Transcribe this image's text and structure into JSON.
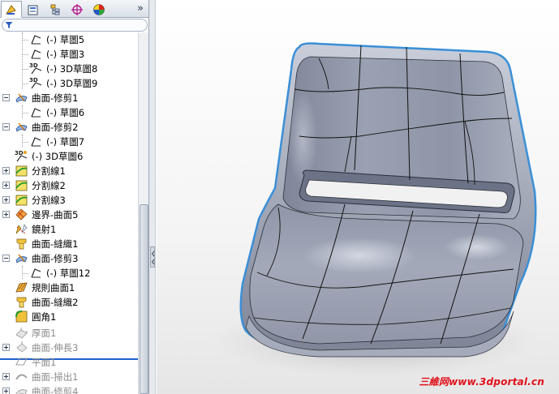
{
  "feature_tree": {
    "items": [
      {
        "label": "(-) 草圖5",
        "icon": "sketch-icon",
        "state": "active"
      },
      {
        "label": "(-) 草圖3",
        "icon": "sketch-icon",
        "state": "active"
      },
      {
        "label": "(-) 3D草圖8",
        "icon": "3d-sketch-icon",
        "state": "active"
      },
      {
        "label": "(-) 3D草圖9",
        "icon": "3d-sketch-icon",
        "state": "active"
      },
      {
        "label": "曲面-修剪1",
        "icon": "trim-surface-icon",
        "state": "active"
      },
      {
        "label": "(-) 草圖6",
        "icon": "sketch-icon",
        "state": "active"
      },
      {
        "label": "曲面-修剪2",
        "icon": "trim-surface-icon",
        "state": "active"
      },
      {
        "label": "(-) 草圖7",
        "icon": "sketch-icon",
        "state": "active"
      },
      {
        "label": "(-) 3D草圖6",
        "icon": "3d-sketch-icon",
        "state": "active"
      },
      {
        "label": "分割線1",
        "icon": "split-line-icon",
        "state": "active"
      },
      {
        "label": "分割線2",
        "icon": "split-line-icon",
        "state": "active"
      },
      {
        "label": "分割線3",
        "icon": "split-line-icon",
        "state": "active"
      },
      {
        "label": "邊界-曲面5",
        "icon": "boundary-surface-icon",
        "state": "active"
      },
      {
        "label": "鏡射1",
        "icon": "mirror-icon",
        "state": "active"
      },
      {
        "label": "曲面-縫織1",
        "icon": "knit-surface-icon",
        "state": "active"
      },
      {
        "label": "曲面-修剪3",
        "icon": "trim-surface-icon",
        "state": "active"
      },
      {
        "label": "(-) 草圖12",
        "icon": "sketch-icon",
        "state": "active"
      },
      {
        "label": "規則曲面1",
        "icon": "ruled-surface-icon",
        "state": "active"
      },
      {
        "label": "曲面-縫織2",
        "icon": "knit-surface-icon",
        "state": "active"
      },
      {
        "label": "圓角1",
        "icon": "fillet-icon",
        "state": "active"
      },
      {
        "label": "厚面1",
        "icon": "thicken-icon",
        "state": "suppressed"
      },
      {
        "label": "曲面-伸長3",
        "icon": "extrude-surface-icon",
        "state": "suppressed"
      },
      {
        "label": "平面1",
        "icon": "plane-icon",
        "state": "suppressed"
      },
      {
        "label": "曲面-掃出1",
        "icon": "sweep-surface-icon",
        "state": "suppressed"
      },
      {
        "label": "曲面-修剪4",
        "icon": "trim-surface-icon",
        "state": "suppressed"
      }
    ]
  },
  "tabs": [
    {
      "name": "feature-manager-tab-icon",
      "active": true
    },
    {
      "name": "property-manager-tab-icon",
      "active": false
    },
    {
      "name": "configuration-manager-tab-icon",
      "active": false
    },
    {
      "name": "dimxpert-manager-tab-icon",
      "active": false
    },
    {
      "name": "display-manager-tab-icon",
      "active": false
    }
  ],
  "tabs_more_glyph": "»",
  "watermark": "三維网www.3dportal.cn",
  "colors": {
    "seat_body": "#8f96a8",
    "seat_highlight": "#c9ceda",
    "seat_edge_glow": "#3a8fd6",
    "rollback_bar": "#1f5fcf",
    "watermark": "#e0101a"
  }
}
